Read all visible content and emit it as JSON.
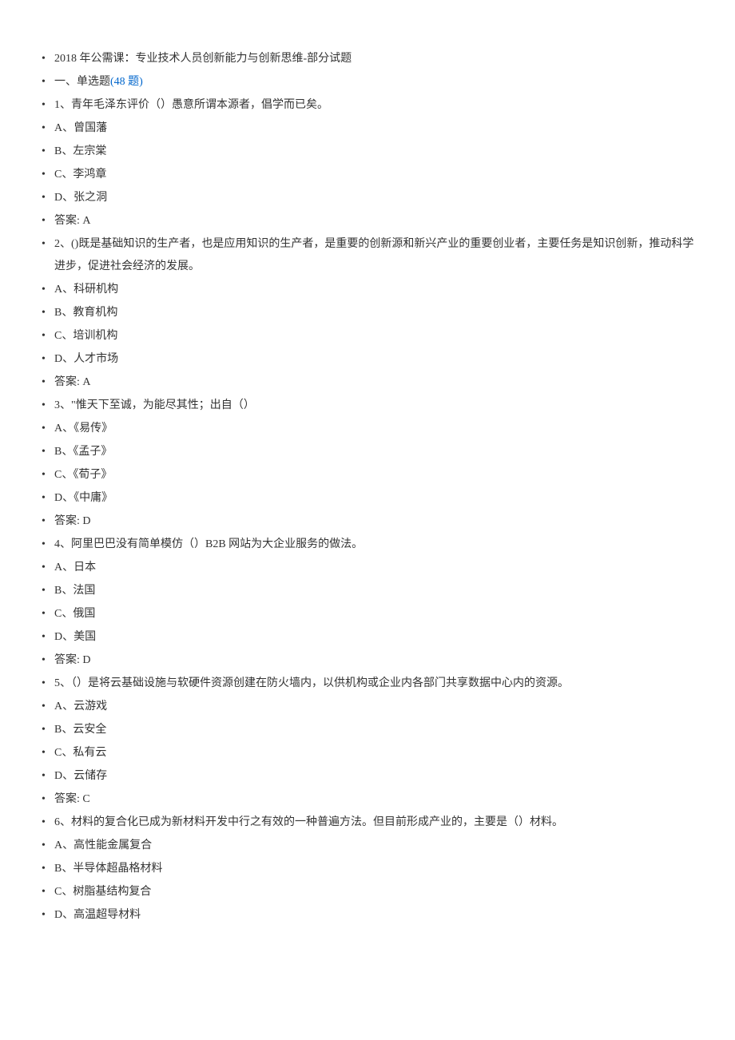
{
  "title": "2018 年公需课：专业技术人员创新能力与创新思维-部分试题",
  "section_heading_prefix": "一、单选题",
  "section_heading_link": "(48 题)",
  "questions": [
    {
      "prompt": "1、青年毛泽东评价（）愚意所谓本源者，倡学而已矣。",
      "options": [
        "A、曾国藩",
        "B、左宗棠",
        "C、李鸿章",
        "D、张之洞"
      ],
      "answer": "答案: A"
    },
    {
      "prompt": "2、()既是基础知识的生产者，也是应用知识的生产者，是重要的创新源和新兴产业的重要创业者，主要任务是知识创新，推动科学进步，促进社会经济的发展。",
      "options": [
        "A、科研机构",
        "B、教育机构",
        "C、培训机构",
        "D、人才市场"
      ],
      "answer": "答案: A"
    },
    {
      "prompt": "3、\"惟天下至诚，为能尽其性；出自（）",
      "options": [
        "A、《易传》",
        "B、《孟子》",
        "C、《荀子》",
        "D、《中庸》"
      ],
      "answer": "答案: D"
    },
    {
      "prompt": "4、阿里巴巴没有简单模仿（）B2B 网站为大企业服务的做法。",
      "options": [
        "A、日本",
        "B、法国",
        "C、俄国",
        "D、美国"
      ],
      "answer": "答案: D"
    },
    {
      "prompt": "5、（）是将云基础设施与软硬件资源创建在防火墙内，以供机构或企业内各部门共享数据中心内的资源。",
      "options": [
        "A、云游戏",
        "B、云安全",
        "C、私有云",
        "D、云储存"
      ],
      "answer": "答案: C"
    },
    {
      "prompt": "6、材料的复合化已成为新材料开发中行之有效的一种普遍方法。但目前形成产业的，主要是（）材料。",
      "options": [
        "A、高性能金属复合",
        "B、半导体超晶格材料",
        "C、树脂基结构复合",
        "D、高温超导材料"
      ],
      "answer": ""
    }
  ]
}
